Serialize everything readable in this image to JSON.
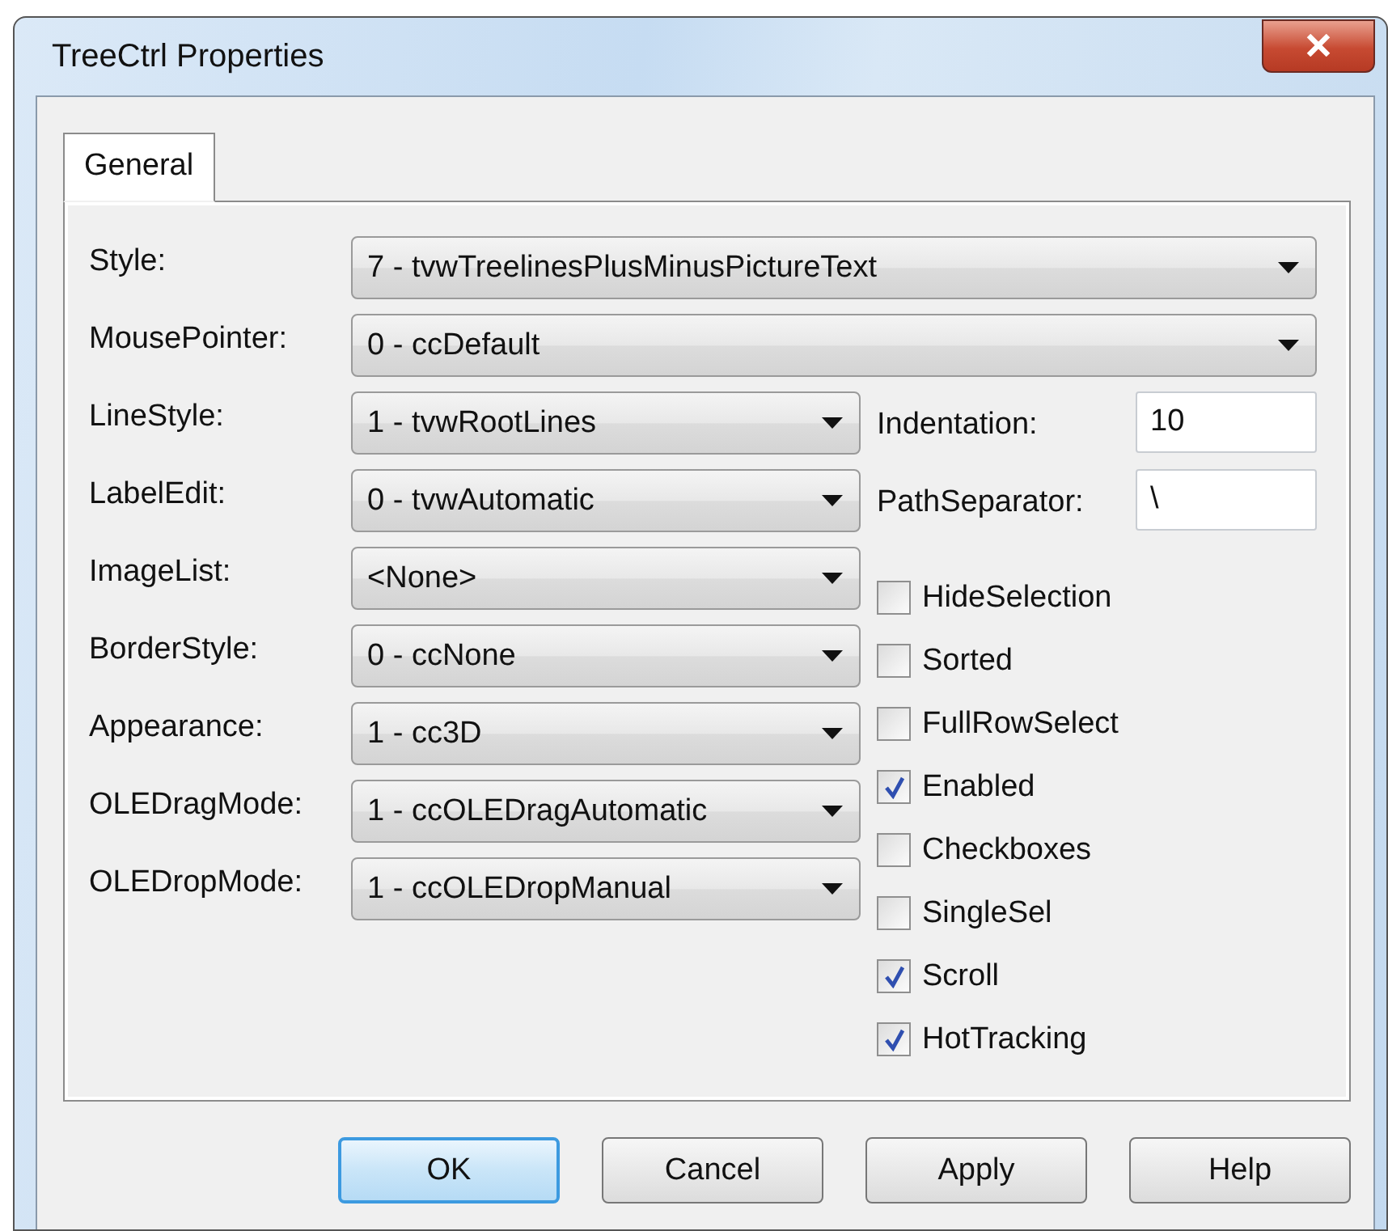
{
  "window": {
    "title": "TreeCtrl Properties"
  },
  "tabs": [
    {
      "label": "General",
      "selected": true
    }
  ],
  "combos": [
    {
      "label": "Style:",
      "value": "7 - tvwTreelinesPlusMinusPictureText",
      "kind": "wide"
    },
    {
      "label": "MousePointer:",
      "value": "0 - ccDefault",
      "kind": "wide"
    },
    {
      "label": "LineStyle:",
      "value": "1 - tvwRootLines",
      "kind": "narrow"
    },
    {
      "label": "LabelEdit:",
      "value": "0 - tvwAutomatic",
      "kind": "narrow"
    },
    {
      "label": "ImageList:",
      "value": "<None>",
      "kind": "narrow"
    },
    {
      "label": "BorderStyle:",
      "value": "0 - ccNone",
      "kind": "narrow"
    },
    {
      "label": "Appearance:",
      "value": "1 - cc3D",
      "kind": "narrow"
    },
    {
      "label": "OLEDragMode:",
      "value": "1 - ccOLEDragAutomatic",
      "kind": "narrow"
    },
    {
      "label": "OLEDropMode:",
      "value": "1 - ccOLEDropManual",
      "kind": "narrow"
    }
  ],
  "text_fields": [
    {
      "label": "Indentation:",
      "value": "10"
    },
    {
      "label": "PathSeparator:",
      "value": "\\"
    }
  ],
  "checkboxes": [
    {
      "label": "HideSelection",
      "checked": false
    },
    {
      "label": "Sorted",
      "checked": false
    },
    {
      "label": "FullRowSelect",
      "checked": false
    },
    {
      "label": "Enabled",
      "checked": true
    },
    {
      "label": "Checkboxes",
      "checked": false
    },
    {
      "label": "SingleSel",
      "checked": false
    },
    {
      "label": "Scroll",
      "checked": true
    },
    {
      "label": "HotTracking",
      "checked": true
    }
  ],
  "buttons": [
    {
      "label": "OK",
      "default": true
    },
    {
      "label": "Cancel",
      "default": false
    },
    {
      "label": "Apply",
      "default": false
    },
    {
      "label": "Help",
      "default": false
    }
  ]
}
